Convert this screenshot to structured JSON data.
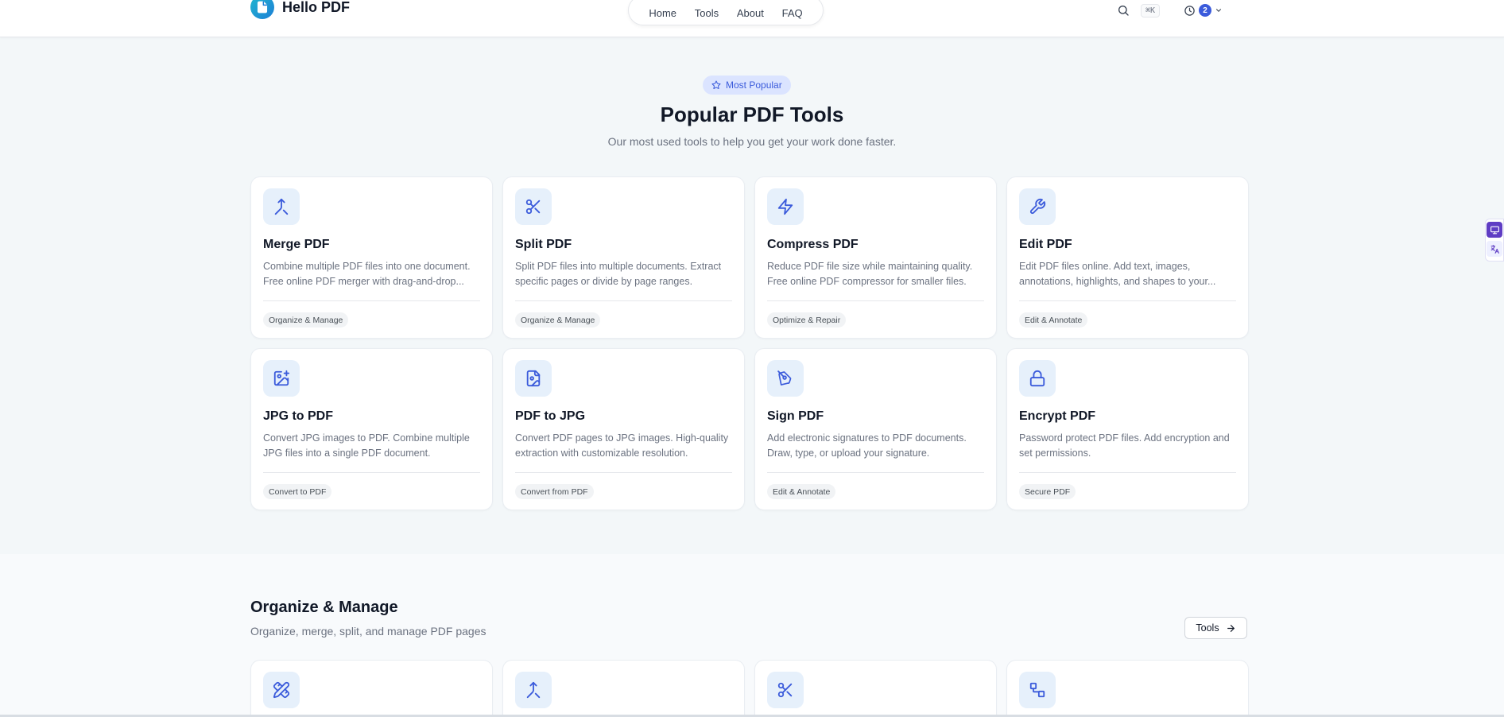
{
  "brand": {
    "name": "Hello PDF"
  },
  "nav": {
    "items": [
      "Home",
      "Tools",
      "About",
      "FAQ"
    ]
  },
  "header": {
    "shortcut": "⌘K",
    "history_count": "2"
  },
  "popular": {
    "pill": "Most Popular",
    "title": "Popular PDF Tools",
    "subtitle": "Our most used tools to help you get your work done faster.",
    "cards": [
      {
        "title": "Merge PDF",
        "desc": "Combine multiple PDF files into one document. Free online PDF merger with drag-and-drop...",
        "tag": "Organize & Manage",
        "icon": "merge-icon"
      },
      {
        "title": "Split PDF",
        "desc": "Split PDF files into multiple documents. Extract specific pages or divide by page ranges.",
        "tag": "Organize & Manage",
        "icon": "scissors-icon"
      },
      {
        "title": "Compress PDF",
        "desc": "Reduce PDF file size while maintaining quality. Free online PDF compressor for smaller files.",
        "tag": "Optimize & Repair",
        "icon": "lightning-icon"
      },
      {
        "title": "Edit PDF",
        "desc": "Edit PDF files online. Add text, images, annotations, highlights, and shapes to your...",
        "tag": "Edit & Annotate",
        "icon": "wrench-icon"
      },
      {
        "title": "JPG to PDF",
        "desc": "Convert JPG images to PDF. Combine multiple JPG files into a single PDF document.",
        "tag": "Convert to PDF",
        "icon": "image-plus-icon"
      },
      {
        "title": "PDF to JPG",
        "desc": "Convert PDF pages to JPG images. High-quality extraction with customizable resolution.",
        "tag": "Convert from PDF",
        "icon": "file-image-icon"
      },
      {
        "title": "Sign PDF",
        "desc": "Add electronic signatures to PDF documents. Draw, type, or upload your signature.",
        "tag": "Edit & Annotate",
        "icon": "pen-tool-icon"
      },
      {
        "title": "Encrypt PDF",
        "desc": "Password protect PDF files. Add encryption and set permissions.",
        "tag": "Secure PDF",
        "icon": "lock-icon"
      }
    ]
  },
  "organize": {
    "title": "Organize & Manage",
    "subtitle": "Organize, merge, split, and manage PDF pages",
    "tools_button": "Tools",
    "card_icons": [
      "pencil-ruler-icon",
      "merge-icon",
      "scissors-icon",
      "blocks-icon"
    ]
  },
  "colors": {
    "accent": "#3b5bdb",
    "icon_bg": "#e6f0fb",
    "brand_gradient_start": "#22b8cf",
    "brand_gradient_end": "#1c7ed6"
  }
}
